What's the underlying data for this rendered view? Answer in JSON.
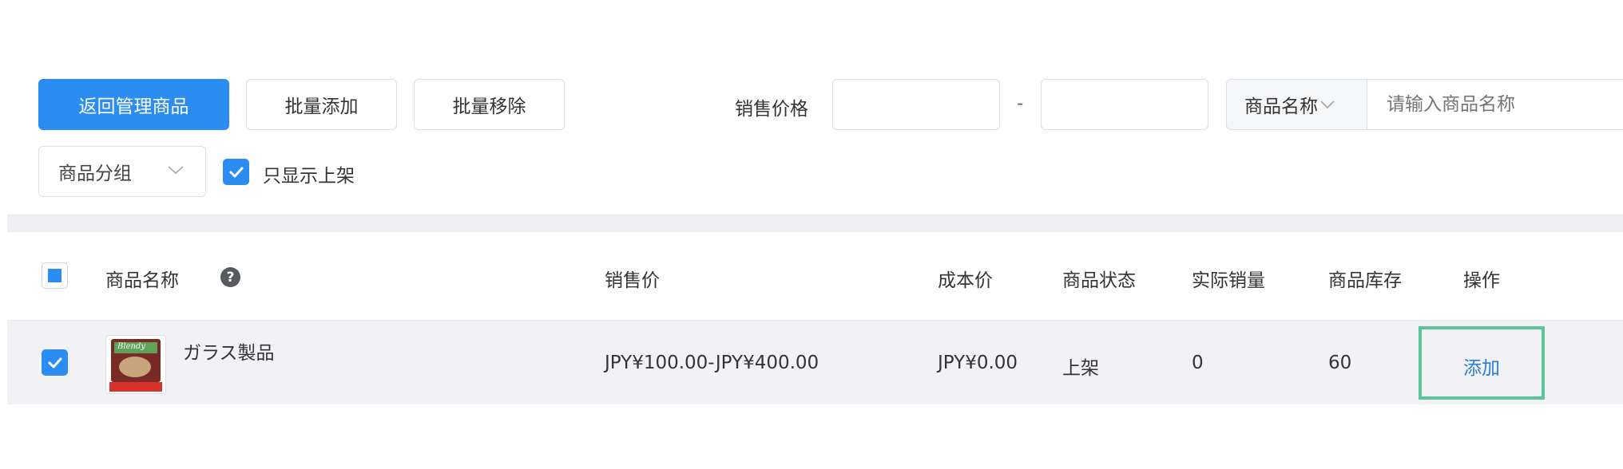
{
  "toolbar": {
    "back_label": "返回管理商品",
    "batch_add_label": "批量添加",
    "batch_remove_label": "批量移除"
  },
  "filters": {
    "price_label": "销售价格",
    "price_separator": "-",
    "price_min_value": "",
    "price_max_value": "",
    "search_field_selected": "商品名称",
    "search_placeholder": "请输入商品名称",
    "group_selected": "商品分组",
    "only_on_shelf_label": "只显示上架",
    "only_on_shelf_checked": true
  },
  "table": {
    "columns": [
      "商品名称",
      "销售价",
      "成本价",
      "商品状态",
      "实际销量",
      "商品库存",
      "操作"
    ],
    "help_icon": "question-circle-icon",
    "rows": [
      {
        "checked": true,
        "name": "ガラス製品",
        "thumbnail_icon": "coffee-product-thumbnail",
        "thumbnail_text": "Blendy",
        "sale_price": "JPY¥100.00-JPY¥400.00",
        "cost_price": "JPY¥0.00",
        "status": "上架",
        "sales": "0",
        "stock": "60",
        "action_label": "添加"
      }
    ]
  },
  "colors": {
    "primary": "#2b8cf2",
    "highlight_border": "#5cc49a",
    "row_background": "#f2f2f6",
    "divider_band": "#eeeef3"
  }
}
